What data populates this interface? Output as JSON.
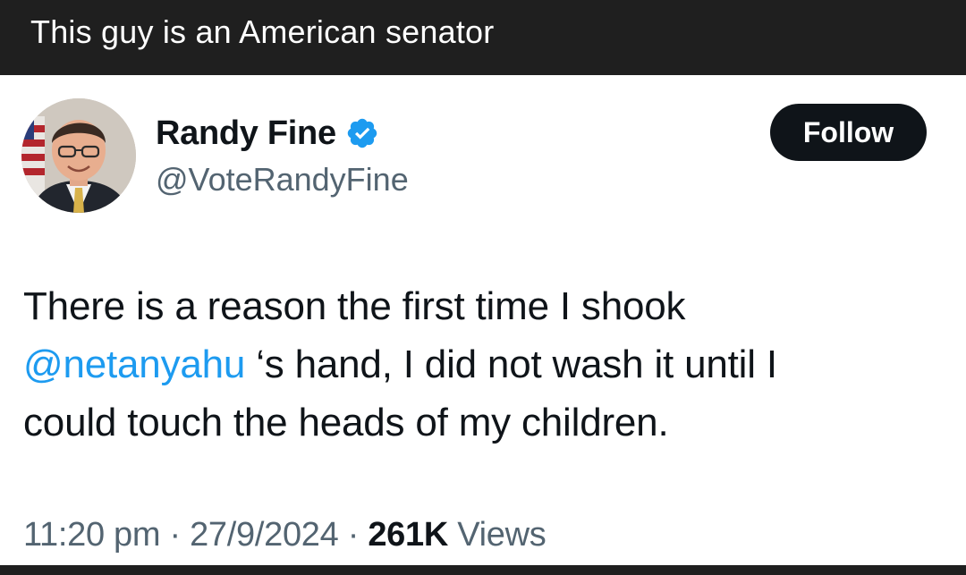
{
  "caption": {
    "text": "This guy is an American senator"
  },
  "tweet": {
    "author": {
      "display_name": "Randy Fine",
      "handle": "@VoteRandyFine",
      "verified": true,
      "avatar_icon": "profile-photo"
    },
    "follow_label": "Follow",
    "text": {
      "line1": "There is a reason the first time I shook",
      "mention": "@netanyahu",
      "line2_rest": " ‘s hand, I did not wash it until I",
      "line3": "could touch the heads of my children."
    },
    "meta": {
      "time": "11:20 pm",
      "separator1": " · ",
      "date": "27/9/2024",
      "separator2": " · ",
      "views_count": "261K",
      "views_label": " Views"
    }
  },
  "colors": {
    "caption_bg": "#1f1f1f",
    "text_primary": "#0f1419",
    "text_secondary": "#536471",
    "link": "#1d9bf0",
    "verified_badge": "#1d9bf0",
    "follow_button_bg": "#0f1419"
  }
}
